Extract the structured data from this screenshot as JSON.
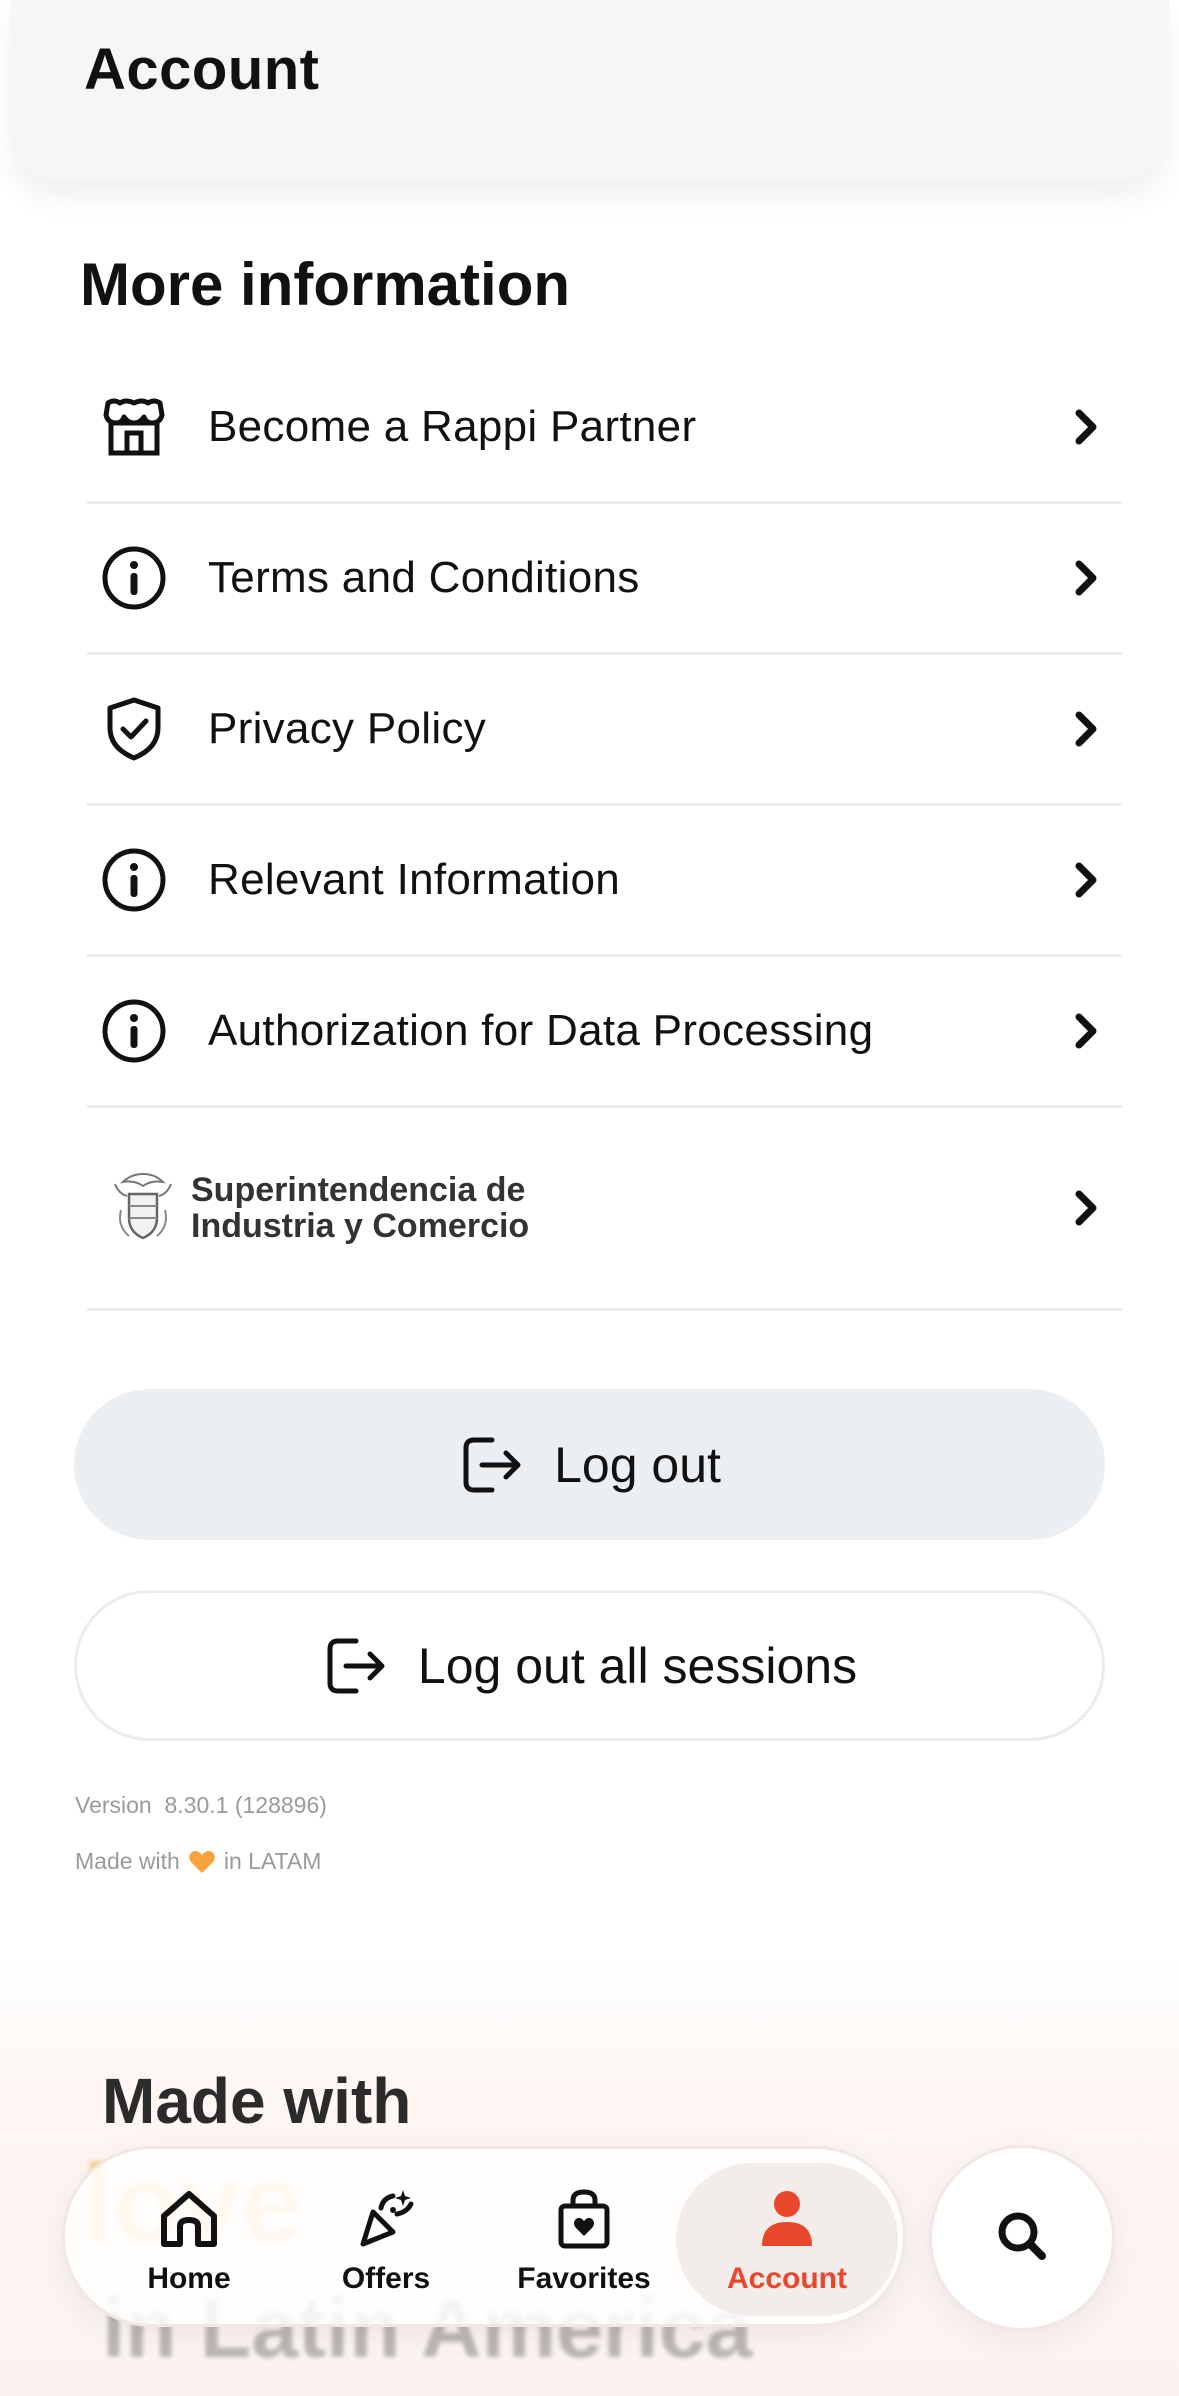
{
  "header": {
    "title": "Account"
  },
  "section": {
    "title": "More information"
  },
  "menu": [
    {
      "label": "Become a Rappi Partner",
      "icon": "store-icon"
    },
    {
      "label": "Terms and Conditions",
      "icon": "info-icon"
    },
    {
      "label": "Privacy Policy",
      "icon": "shield-icon"
    },
    {
      "label": "Relevant Information",
      "icon": "info-icon"
    },
    {
      "label": "Authorization for Data Processing",
      "icon": "info-icon"
    }
  ],
  "sic": {
    "line1": "Superintendencia de",
    "line2": "Industria y Comercio"
  },
  "buttons": {
    "logout": "Log out",
    "logout_all": "Log out all sessions"
  },
  "footer": {
    "version_label": "Version",
    "version": "8.30.1 (128896)",
    "made_prefix": "Made with",
    "made_suffix": "in LATAM"
  },
  "promo": {
    "line1": "Made with",
    "line2": "love",
    "line3": "in Latin America"
  },
  "tabs": [
    {
      "label": "Home",
      "icon": "home-icon"
    },
    {
      "label": "Offers",
      "icon": "party-icon"
    },
    {
      "label": "Favorites",
      "icon": "shopping-bag-heart-icon"
    },
    {
      "label": "Account",
      "icon": "user-icon",
      "active": true
    }
  ],
  "colors": {
    "accent": "#e8472b",
    "heart": "#f5a33a",
    "button_bg": "#eceff2"
  }
}
